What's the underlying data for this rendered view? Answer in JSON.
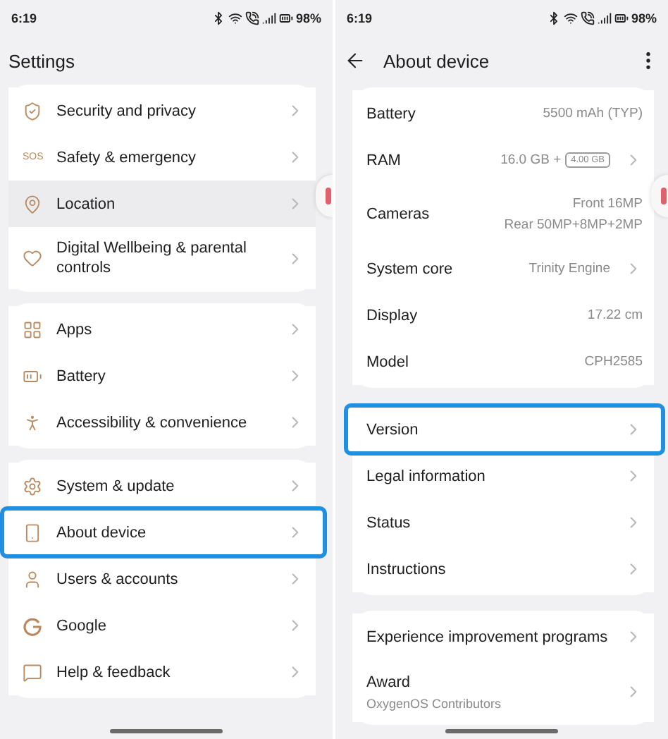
{
  "left": {
    "status_bar": {
      "time": "6:19",
      "battery": "98%"
    },
    "title": "Settings",
    "groups": [
      {
        "items": [
          {
            "label": "Security and privacy",
            "highlighted": false,
            "selected": false
          },
          {
            "label": "Safety & emergency",
            "icon_text": "SOS",
            "highlighted": false,
            "selected": false
          },
          {
            "label": "Location",
            "highlighted": true,
            "selected": false
          },
          {
            "label": "Digital Wellbeing & parental controls",
            "highlighted": false,
            "selected": false
          }
        ]
      },
      {
        "items": [
          {
            "label": "Apps",
            "highlighted": false,
            "selected": false
          },
          {
            "label": "Battery",
            "highlighted": false,
            "selected": false
          },
          {
            "label": "Accessibility & convenience",
            "highlighted": false,
            "selected": false
          }
        ]
      },
      {
        "items": [
          {
            "label": "System & update",
            "highlighted": false,
            "selected": false
          },
          {
            "label": "About device",
            "highlighted": false,
            "selected": true
          },
          {
            "label": "Users & accounts",
            "highlighted": false,
            "selected": false
          },
          {
            "label": "Google",
            "highlighted": false,
            "selected": false
          },
          {
            "label": "Help & feedback",
            "highlighted": false,
            "selected": false
          }
        ]
      }
    ]
  },
  "right": {
    "status_bar": {
      "time": "6:19",
      "battery": "98%"
    },
    "title": "About device",
    "groups": [
      {
        "items": [
          {
            "label": "Battery",
            "values": [
              "5500 mAh (TYP)"
            ],
            "chevron": false,
            "selected": false
          },
          {
            "label": "RAM",
            "values": [
              "16.0 GB +"
            ],
            "badge": "4.00 GB",
            "chevron": true,
            "selected": false
          },
          {
            "label": "Cameras",
            "values": [
              "Front 16MP",
              "Rear 50MP+8MP+2MP"
            ],
            "chevron": false,
            "selected": false
          },
          {
            "label": "System core",
            "values": [
              "Trinity Engine"
            ],
            "chevron": true,
            "selected": false
          },
          {
            "label": "Display",
            "values": [
              "17.22 cm"
            ],
            "chevron": false,
            "selected": false
          },
          {
            "label": "Model",
            "values": [
              "CPH2585"
            ],
            "chevron": false,
            "selected": false
          }
        ]
      },
      {
        "items": [
          {
            "label": "Version",
            "chevron": true,
            "selected": true
          },
          {
            "label": "Legal information",
            "chevron": true,
            "selected": false
          },
          {
            "label": "Status",
            "chevron": true,
            "selected": false
          },
          {
            "label": "Instructions",
            "chevron": true,
            "selected": false
          }
        ]
      },
      {
        "items": [
          {
            "label": "Experience improvement programs",
            "chevron": true,
            "selected": false
          },
          {
            "label": "Award",
            "subtitle": "OxygenOS Contributors",
            "chevron": true,
            "selected": false
          }
        ]
      }
    ]
  }
}
